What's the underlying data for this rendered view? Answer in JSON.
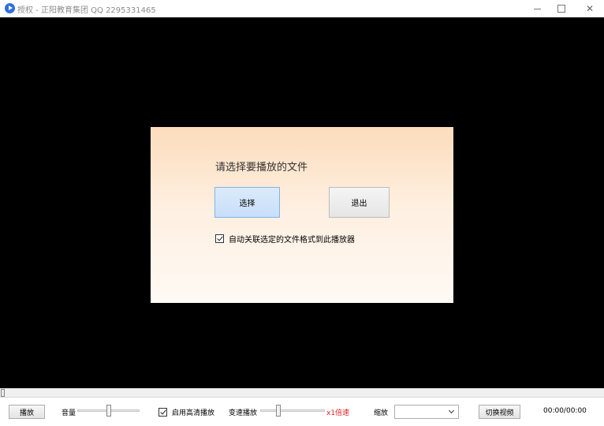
{
  "window": {
    "title": "授权 - 正阳教育集团 QQ 2295331465",
    "controls": {
      "minimize": "—",
      "maximize": "☐",
      "close": "✕"
    }
  },
  "dialog": {
    "prompt": "请选择要播放的文件",
    "select_label": "选择",
    "exit_label": "退出",
    "assoc_label": "自动关联选定的文件格式到此播放器",
    "assoc_checked": true
  },
  "progress": {
    "value": 0
  },
  "controls": {
    "play_label": "播放",
    "volume_label": "音量",
    "volume_level": 0.5,
    "hd_label": "启用高清播放",
    "hd_checked": true,
    "speed_label": "变速播放",
    "speed_level": 0.25,
    "speed_value": "x1倍速",
    "zoom_label": "缩放",
    "zoom_value": "",
    "switch_label": "切换视频",
    "time": "00:00/00:00"
  },
  "colors": {
    "accent": "#7eb4ea",
    "speed_text": "#e02020",
    "video_bg": "#000000"
  }
}
